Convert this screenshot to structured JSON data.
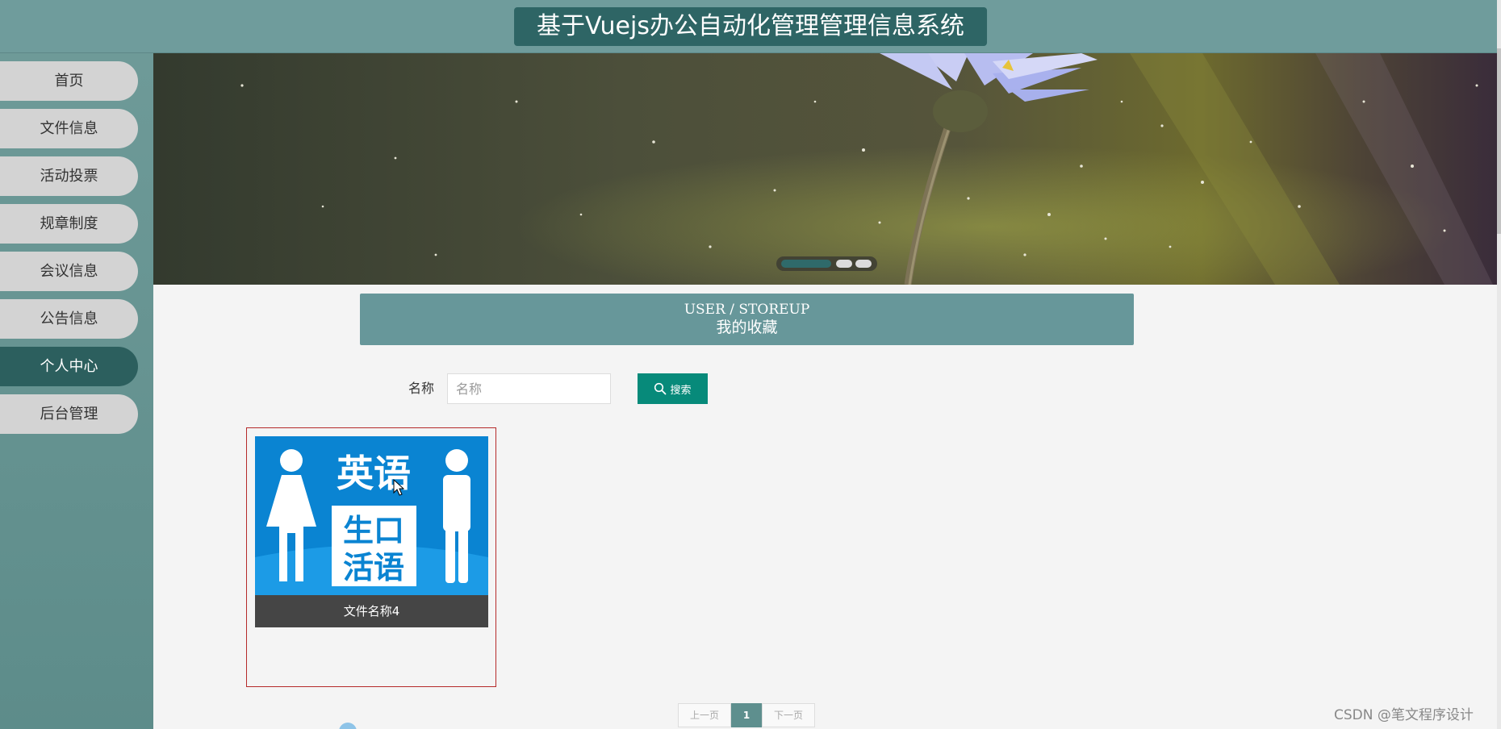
{
  "header": {
    "title": "基于Vuejs办公自动化管理管理信息系统"
  },
  "sidebar": {
    "items": [
      {
        "label": "首页",
        "active": false
      },
      {
        "label": "文件信息",
        "active": false
      },
      {
        "label": "活动投票",
        "active": false
      },
      {
        "label": "规章制度",
        "active": false
      },
      {
        "label": "会议信息",
        "active": false
      },
      {
        "label": "公告信息",
        "active": false
      },
      {
        "label": "个人中心",
        "active": true
      },
      {
        "label": "后台管理",
        "active": false
      }
    ]
  },
  "banner": {
    "slide_count": 3,
    "active_slide": 1
  },
  "section": {
    "title_en": "USER / STOREUP",
    "title_cn": "我的收藏"
  },
  "search": {
    "label": "名称",
    "placeholder": "名称",
    "value": "",
    "button_label": "搜索",
    "button_icon": "search-icon"
  },
  "items": [
    {
      "name": "文件名称4",
      "image_text": [
        "英语",
        "生口",
        "活语"
      ]
    }
  ],
  "pagination": {
    "prev_label": "上一页",
    "current_page": "1",
    "next_label": "下一页"
  },
  "watermark": "CSDN @笔文程序设计",
  "colors": {
    "header_bg": "#6f9c9c",
    "title_bg": "#2e6565",
    "sidebar_active": "#2c5f5e",
    "section_bg": "#67979a",
    "search_button": "#078a7a",
    "card_border": "#b52a2a",
    "card_image_bg": "#0a84d2"
  }
}
